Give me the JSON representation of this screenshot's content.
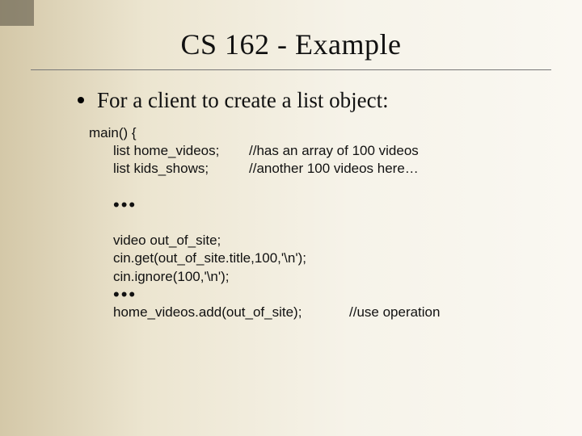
{
  "title": "CS 162 - Example",
  "bullet": "For a client to create a list object:",
  "code": {
    "main_open": "main() {",
    "decl1_l": "list home_videos;",
    "decl1_r": "//has an array of 100 videos",
    "decl2_l": "list kids_shows;",
    "decl2_r": "//another 100 videos here…",
    "dots1": "•••",
    "video_decl": "video out_of_site;",
    "cin_get": "cin.get(out_of_site.title,100,'\\n');",
    "cin_ignore": "cin.ignore(100,'\\n');",
    "dots2": "•••",
    "add_call": "home_videos.add(out_of_site);",
    "add_comment": "//use operation"
  }
}
